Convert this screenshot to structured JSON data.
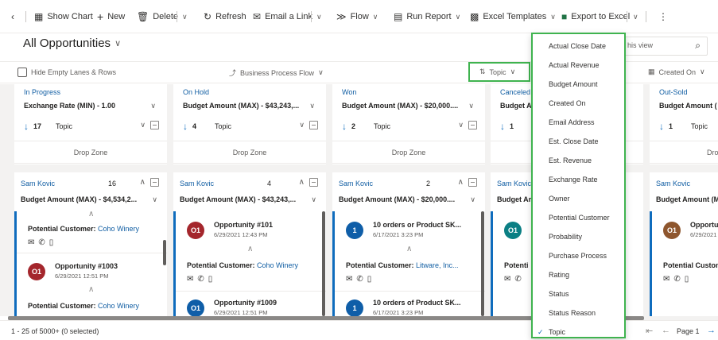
{
  "toolbar": {
    "back_icon": "back-arrow-icon",
    "show_chart": "Show Chart",
    "new": "New",
    "delete": "Delete",
    "refresh": "Refresh",
    "email_link": "Email a Link",
    "flow": "Flow",
    "run_report": "Run Report",
    "excel_templates": "Excel Templates",
    "export_excel": "Export to Excel",
    "excel_color": "#217346"
  },
  "view": {
    "title": "All Opportunities",
    "search_placeholder": "Search this view",
    "search_visible": "his view"
  },
  "filterbar": {
    "hide_empty": "Hide Empty Lanes & Rows",
    "bpf": "Business Process Flow",
    "sort": "Topic",
    "created_on": "Created On"
  },
  "lanes": [
    {
      "stage": "In Progress",
      "agg": "Exchange Rate (MIN) - 1.00",
      "count": "17",
      "sort": "Topic",
      "group_owner": "Sam Kovic",
      "group_count": "16",
      "group_agg": "Budget Amount (MAX) - $4,534,2..."
    },
    {
      "stage": "On Hold",
      "agg": "Budget Amount (MAX) - $43,243,...",
      "count": "4",
      "sort": "Topic",
      "group_owner": "Sam Kovic",
      "group_count": "4",
      "group_agg": "Budget Amount (MAX) - $43,243,..."
    },
    {
      "stage": "Won",
      "agg": "Budget Amount (MAX) - $20,000....",
      "count": "2",
      "sort": "Topic",
      "group_owner": "Sam Kovic",
      "group_count": "2",
      "group_agg": "Budget Amount (MAX) - $20,000...."
    },
    {
      "stage": "Canceled",
      "agg": "Budget A",
      "count": "1",
      "sort": "",
      "group_owner": "Sam Kovic",
      "group_count": "",
      "group_agg": "Budget Am"
    },
    {
      "stage": "Out-Sold",
      "agg": "Budget Amount (",
      "count": "1",
      "sort": "Topic",
      "group_owner": "Sam Kovic",
      "group_count": "",
      "group_agg": "Budget Amount (M"
    }
  ],
  "drop_zone": "Drop Zone",
  "cards": {
    "lane1": {
      "c1_label": "Potential Customer:",
      "c1_value": "Coho Winery",
      "c2_initials": "O1",
      "c2_title": "Opportunity #1003",
      "c2_date": "6/29/2021 12:51 PM",
      "c3_label": "Potential Customer:",
      "c3_value": "Coho Winery"
    },
    "lane2": {
      "c1_initials": "O1",
      "c1_title": "Opportunity #101",
      "c1_date": "6/29/2021 12:43 PM",
      "c1_label": "Potential Customer:",
      "c1_value": "Coho Winery",
      "c2_initials": "O1",
      "c2_title": "Opportunity #1009",
      "c2_date": "6/29/2021 12:51 PM"
    },
    "lane3": {
      "c1_initials": "1",
      "c1_title": "10 orders or Product SK...",
      "c1_date": "6/17/2021 3:23 PM",
      "c1_label": "Potential Customer:",
      "c1_value": "Litware, Inc...",
      "c2_initials": "1",
      "c2_title": "10 orders of Product SK...",
      "c2_date": "6/17/2021 3:23 PM"
    },
    "lane4": {
      "c1_initials": "O1",
      "c1_label": "Potenti"
    },
    "lane5": {
      "c1_initials": "O1",
      "c1_title": "Opportun",
      "c1_date": "6/29/2021",
      "c1_label": "Potential Custom"
    }
  },
  "avatar_colors": {
    "red": "#a4262c",
    "blue": "#0f5ea8",
    "teal": "#0b7f84",
    "brown": "#8e562e"
  },
  "statusbar": {
    "record_count": "1 - 25 of 5000+ (0 selected)",
    "page": "Page 1"
  },
  "sort_menu": {
    "items": [
      "Actual Close Date",
      "Actual Revenue",
      "Budget Amount",
      "Created On",
      "Email Address",
      "Est. Close Date",
      "Est. Revenue",
      "Exchange Rate",
      "Owner",
      "Potential Customer",
      "Probability",
      "Purchase Process",
      "Rating",
      "Status",
      "Status Reason",
      "Topic"
    ],
    "selected": "Topic"
  }
}
